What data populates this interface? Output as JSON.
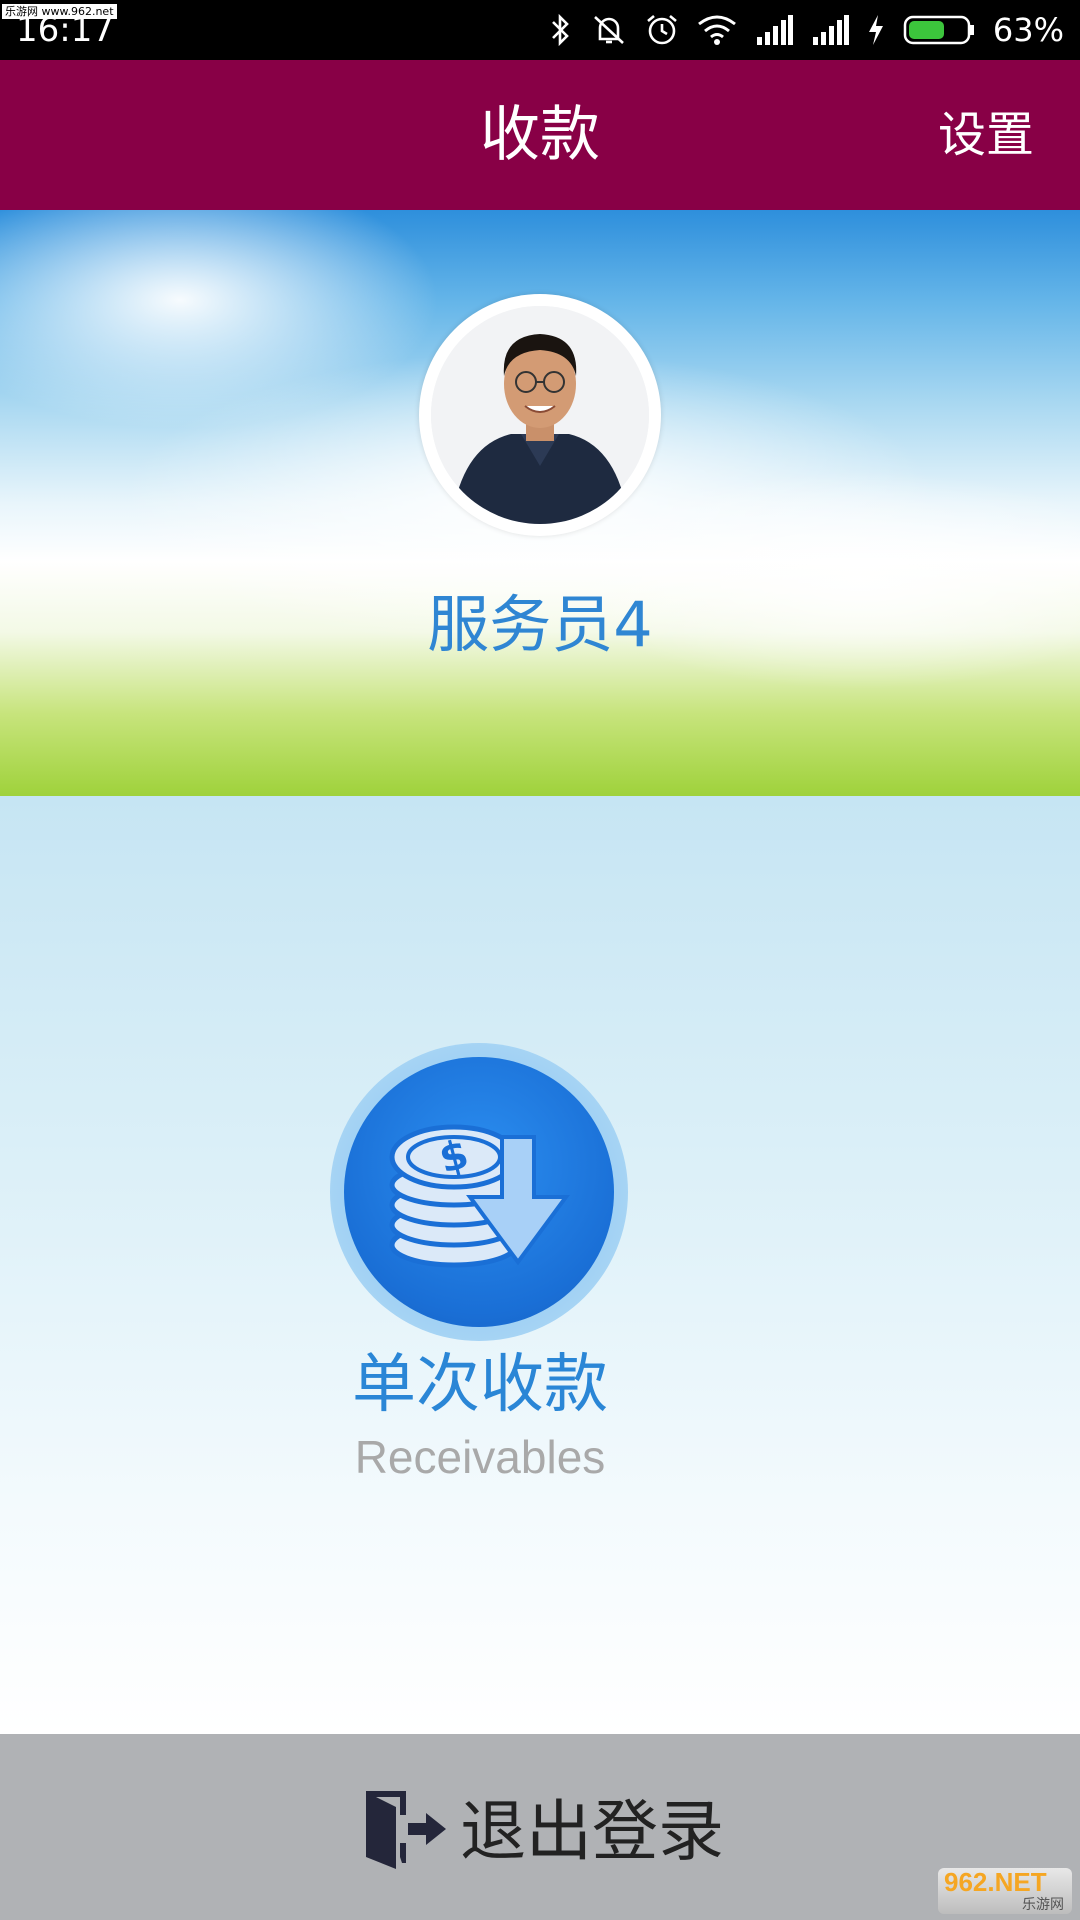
{
  "status_bar": {
    "watermark": "乐游网 www.962.net",
    "time": "16:17",
    "battery_percent": "63%",
    "battery_level": 0.63,
    "icons": [
      "bluetooth-icon",
      "mute-icon",
      "alarm-icon",
      "wifi-icon",
      "signal-icon",
      "signal-icon",
      "charging-icon",
      "battery-icon"
    ]
  },
  "appbar": {
    "title": "收款",
    "settings_label": "设置",
    "background": "#880046"
  },
  "profile": {
    "name": "服务员4"
  },
  "main": {
    "receive": {
      "label": "单次收款",
      "sublabel": "Receivables",
      "icon": "coins-download-icon"
    }
  },
  "footer": {
    "logout_label": "退出登录",
    "logout_icon": "exit-door-icon"
  },
  "watermark_bottom": {
    "main": "962.NET",
    "sub": "乐游网"
  }
}
